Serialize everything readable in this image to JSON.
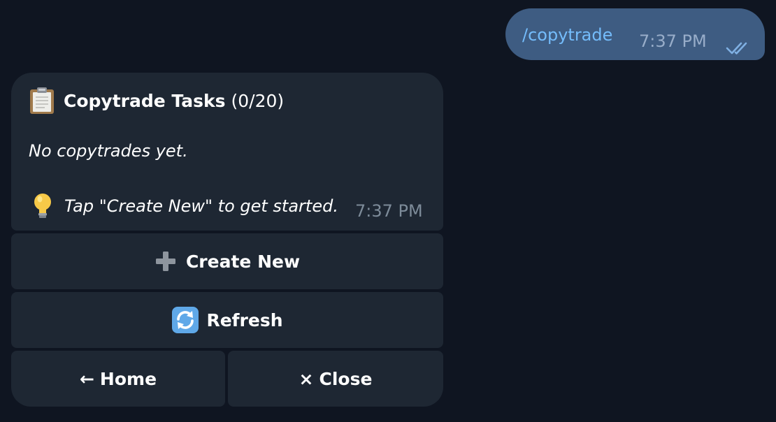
{
  "outgoing": {
    "text": "/copytrade",
    "time": "7:37 PM",
    "status_icon": "double-check-icon"
  },
  "incoming": {
    "title_icon": "clipboard-icon",
    "title": "Copytrade Tasks",
    "count": "(0/20)",
    "empty_message": "No copytrades yet.",
    "tip_icon": "lightbulb-icon",
    "tip": "Tap \"Create New\" to get started.",
    "time": "7:37 PM"
  },
  "buttons": {
    "create": {
      "icon": "plus-icon",
      "label": "Create New"
    },
    "refresh": {
      "icon": "refresh-icon",
      "label": "Refresh"
    },
    "home": {
      "glyph": "←",
      "label": "Home"
    },
    "close": {
      "glyph": "×",
      "label": "Close"
    }
  },
  "colors": {
    "background": "#0f1521",
    "outgoing_bubble": "#3e5c82",
    "incoming_bubble": "#1e2733",
    "link_text": "#74bcfb"
  }
}
